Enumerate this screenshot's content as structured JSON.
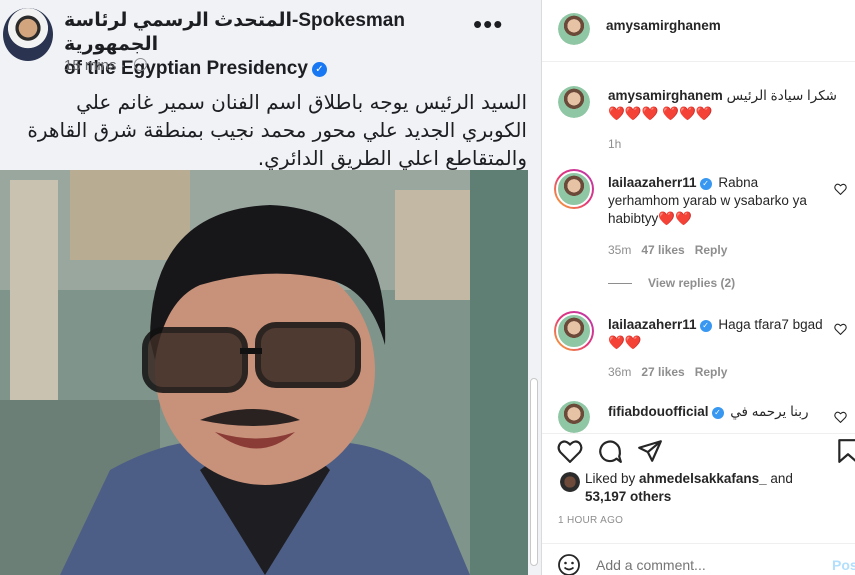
{
  "facebook": {
    "name_line1": "Spokesman-المتحدث الرسمي لرئاسة الجمهورية",
    "name_line2": "of the Egyptian Presidency",
    "time": "15 mins",
    "post_text": "السيد الرئيس يوجه باطلاق اسم الفنان سمير غانم علي الكوبري الجديد علي محور محمد نجيب بمنطقة شرق القاهرة والمتقاطع اعلي الطريق الدائري."
  },
  "instagram": {
    "header_username": "amysamirghanem",
    "comments": [
      {
        "username": "amysamirghanem",
        "text": "شكرا سيادة الرئيس ❤️❤️❤️ ❤️❤️❤️",
        "time": "1h"
      },
      {
        "username": "lailaazaherr11",
        "text": "Rabna yerhamhom yarab w ysabarko ya habibtyy❤️❤️",
        "time": "35m",
        "likes": "47 likes",
        "reply": "Reply",
        "view_replies": "View replies (2)"
      },
      {
        "username": "lailaazaherr11",
        "text": "Haga tfara7 bgad❤️❤️",
        "time": "36m",
        "likes": "27 likes",
        "reply": "Reply"
      },
      {
        "username": "fifiabdouofficial",
        "text": "ربنا يرحمه في"
      }
    ],
    "liked_by_prefix": "Liked by ",
    "liked_by_user": "ahmedelsakkafans_",
    "liked_by_and": " and",
    "liked_by_others": "53,197 others",
    "posted_ago": "1 HOUR AGO",
    "add_comment_placeholder": "Add a comment...",
    "post_label": "Pos"
  },
  "colors": {
    "verified": "#3897f0",
    "fb_verified": "#1877f2",
    "post_button": "#b2dffc"
  }
}
